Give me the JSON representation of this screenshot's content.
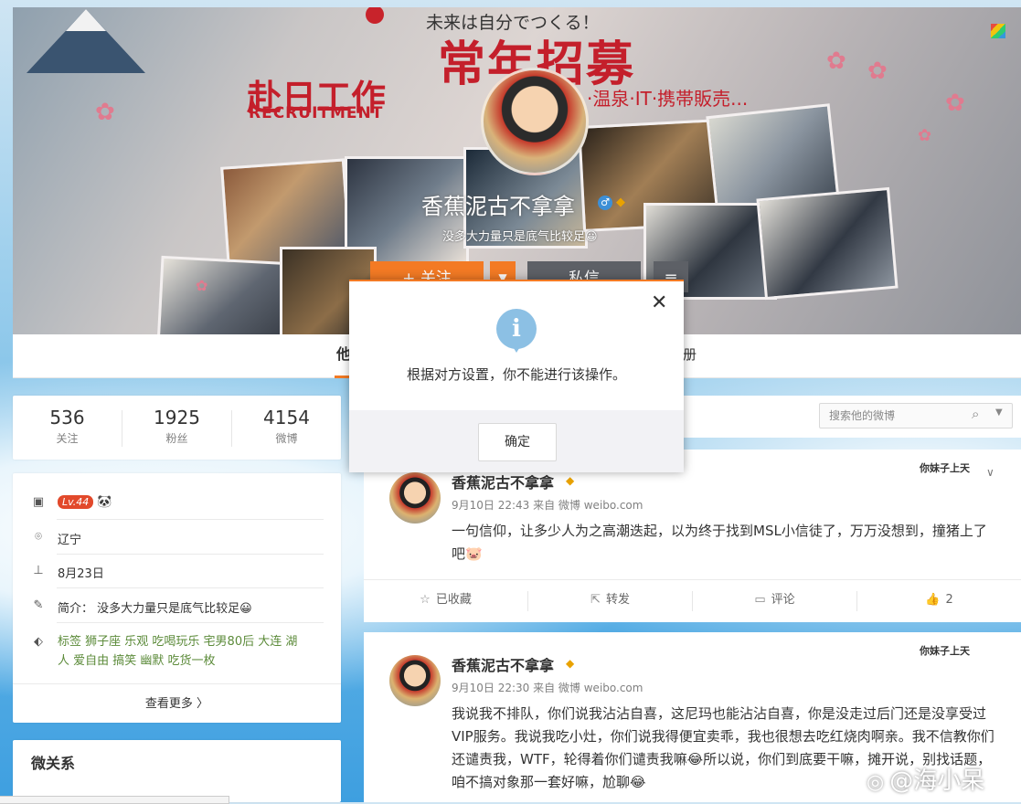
{
  "cover": {
    "slogan_top": "未来は自分でつくる！",
    "headline_red": "赴日工作",
    "headline_big": "常年招募",
    "recruitment": "RECRUITMENT",
    "sub_banner": "·温泉·IT·携帯販売...",
    "username": "香蕉泥古不拿拿",
    "bio": "没多大力量只是底气比较足😀"
  },
  "profile_actions": {
    "follow_label": "+ 关注",
    "dropdown_glyph": "▼",
    "message_label": "私信",
    "menu_glyph": "≡"
  },
  "tabs": {
    "active_label": "他",
    "right_label": "册"
  },
  "stats": [
    {
      "value": "536",
      "label": "关注"
    },
    {
      "value": "1925",
      "label": "粉丝"
    },
    {
      "value": "4154",
      "label": "微博"
    }
  ],
  "info": {
    "level": "Lv.44",
    "location": "辽宁",
    "birthday": "8月23日",
    "intro_label": "简介：",
    "intro_text": "没多大力量只是底气比较足😀",
    "tags_label": "标签",
    "tags_line1": "狮子座 乐观 吃喝玩乐 宅男80后 大连 湖",
    "tags_line2": "人 爱自由 搞笑 幽默 吃货一枚",
    "view_more": "查看更多 〉"
  },
  "relations_title": "微关系",
  "search": {
    "placeholder": "搜索他的微博"
  },
  "posts": [
    {
      "author": "香蕉泥古不拿拿",
      "meta": "9月10日 22:43 来自 微博 weibo.com",
      "text": "一句信仰，让多少人为之高潮迭起，以为终于找到MSL小信徒了，万万没想到，撞猪上了吧🐷",
      "badge_text": "你妹子上天",
      "actions": {
        "fav": "已收藏",
        "repost": "转发",
        "comment": "评论",
        "like": "2"
      }
    },
    {
      "author": "香蕉泥古不拿拿",
      "meta": "9月10日 22:30 来自 微博 weibo.com",
      "text": "我说我不排队，你们说我沾沾自喜，这尼玛也能沾沾自喜，你是没走过后门还是没享受过VIP服务。我说我吃小灶，你们说我得便宜卖乖，我也很想去吃红烧肉啊亲。我不信教你们还谴责我，WTF，轮得着你们谴责我嘛😂所以说，你们到底要干嘛，摊开说，别找话题，咱不搞对象那一套好嘛，尬聊😂",
      "badge_text": "你妹子上天"
    }
  ],
  "modal": {
    "message": "根据对方设置，你不能进行该操作。",
    "ok_label": "确定",
    "close_glyph": "✕"
  },
  "watermark": "@海小呆",
  "colors": {
    "accent": "#f37a24",
    "dark_button": "#5d6066",
    "info_icon": "#8cc0e4",
    "level_badge": "#e2492b",
    "tag_text": "#5c8b3a"
  }
}
